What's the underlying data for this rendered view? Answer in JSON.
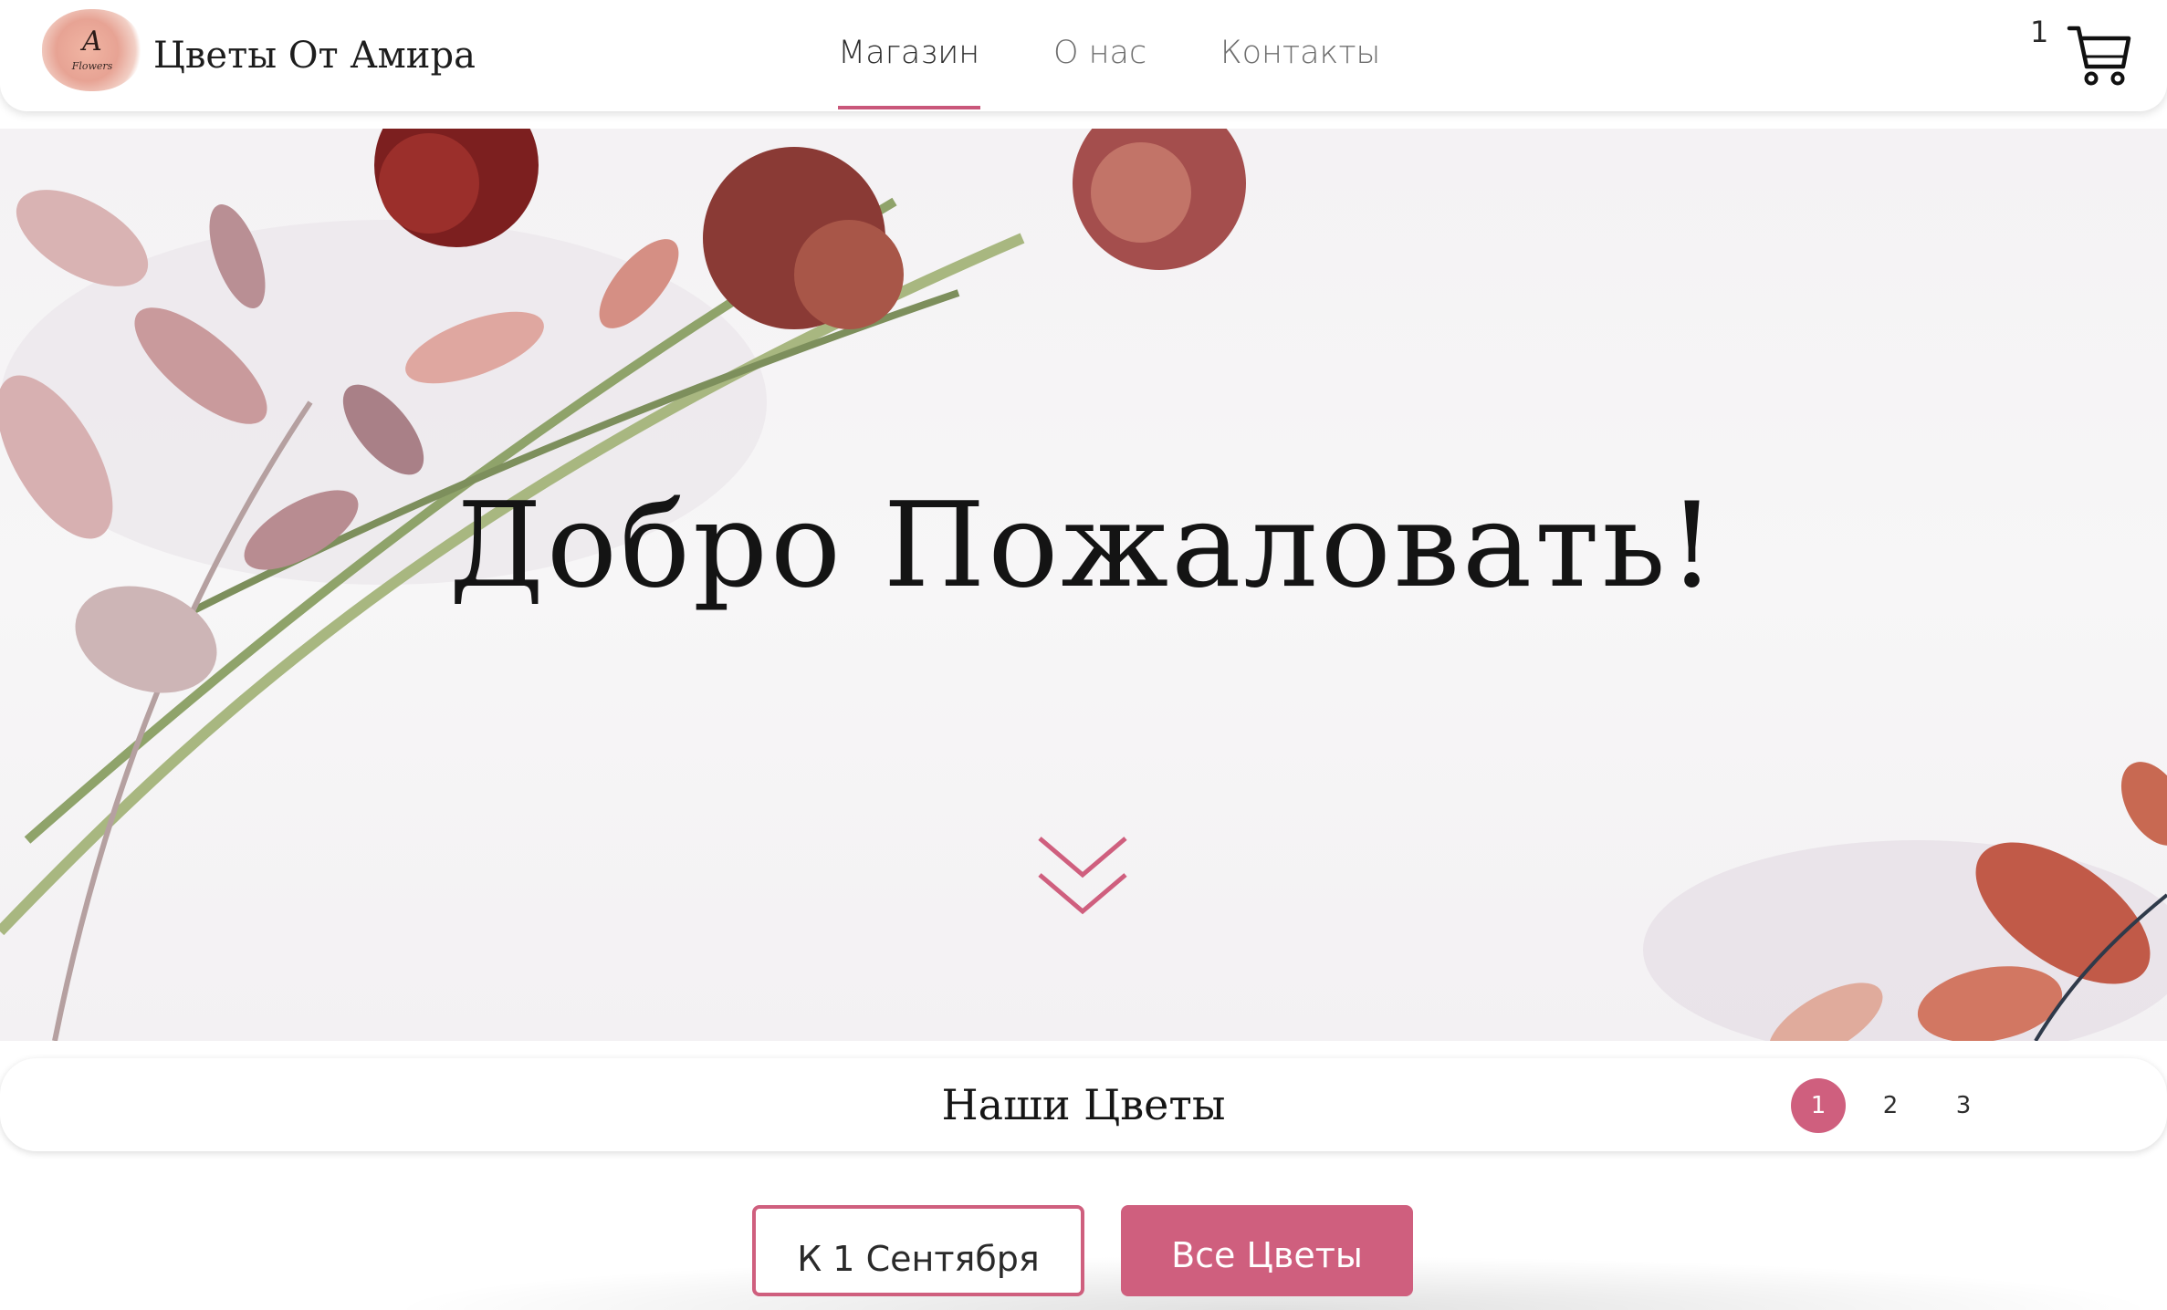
{
  "header": {
    "logo_letter": "A",
    "logo_subtext": "Flowers",
    "brand_name": "Цветы От Амира",
    "nav": [
      {
        "label": "Магазин",
        "active": true
      },
      {
        "label": "О нас",
        "active": false
      },
      {
        "label": "Контакты",
        "active": false
      }
    ],
    "cart_count": "1",
    "cart_icon": "shopping-cart-icon"
  },
  "hero": {
    "title": "Добро Пожаловать!",
    "scroll_icon": "double-chevron-down-icon"
  },
  "section": {
    "title": "Наши Цветы",
    "pages": [
      "1",
      "2",
      "3"
    ],
    "active_page": "1"
  },
  "filters": [
    {
      "label": "К 1 Сентября",
      "style": "outline"
    },
    {
      "label": "Все Цветы",
      "style": "filled"
    }
  ],
  "colors": {
    "accent": "#cf5f7e",
    "text_dark": "#141414",
    "nav_text": "#6f6f6f"
  }
}
